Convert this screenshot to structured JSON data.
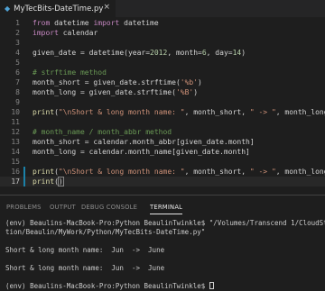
{
  "tab": {
    "title": "MyTecBits-DateTime.py",
    "close_glyph": "×",
    "file_icon_glyph": "◆"
  },
  "editor": {
    "active_line": 17,
    "lines": [
      {
        "num": "1",
        "tokens": [
          {
            "t": "from",
            "c": "kw"
          },
          {
            "t": " datetime "
          },
          {
            "t": "import",
            "c": "kw"
          },
          {
            "t": " datetime"
          }
        ]
      },
      {
        "num": "2",
        "tokens": [
          {
            "t": "import",
            "c": "kw"
          },
          {
            "t": " calendar"
          }
        ]
      },
      {
        "num": "3",
        "tokens": []
      },
      {
        "num": "4",
        "tokens": [
          {
            "t": "given_date = datetime(year="
          },
          {
            "t": "2012",
            "c": "num"
          },
          {
            "t": ", month="
          },
          {
            "t": "6",
            "c": "num"
          },
          {
            "t": ", day="
          },
          {
            "t": "14",
            "c": "num"
          },
          {
            "t": ")"
          }
        ]
      },
      {
        "num": "5",
        "tokens": []
      },
      {
        "num": "6",
        "tokens": [
          {
            "t": "# strftime method",
            "c": "cm"
          }
        ]
      },
      {
        "num": "7",
        "tokens": [
          {
            "t": "month_short = given_date.strftime("
          },
          {
            "t": "'%b'",
            "c": "str"
          },
          {
            "t": ")"
          }
        ]
      },
      {
        "num": "8",
        "tokens": [
          {
            "t": "month_long = given_date.strftime("
          },
          {
            "t": "'%B'",
            "c": "str"
          },
          {
            "t": ")"
          }
        ]
      },
      {
        "num": "9",
        "tokens": []
      },
      {
        "num": "10",
        "tokens": [
          {
            "t": "print",
            "c": "fn"
          },
          {
            "t": "("
          },
          {
            "t": "\"\\nShort & long month name: \"",
            "c": "str"
          },
          {
            "t": ", month_short, "
          },
          {
            "t": "\" -> \"",
            "c": "str"
          },
          {
            "t": ", month_long)"
          }
        ]
      },
      {
        "num": "11",
        "tokens": []
      },
      {
        "num": "12",
        "tokens": [
          {
            "t": "# month_name / month_abbr method",
            "c": "cm"
          }
        ]
      },
      {
        "num": "13",
        "tokens": [
          {
            "t": "month_short = calendar.month_abbr[given_date.month]"
          }
        ]
      },
      {
        "num": "14",
        "tokens": [
          {
            "t": "month_long = calendar.month_name[given_date.month]"
          }
        ]
      },
      {
        "num": "15",
        "tokens": []
      },
      {
        "num": "16",
        "tokens": [
          {
            "t": "print",
            "c": "fn"
          },
          {
            "t": "("
          },
          {
            "t": "\"\\nShort & long month name: \"",
            "c": "str"
          },
          {
            "t": ", month_short, "
          },
          {
            "t": "\" -> \"",
            "c": "str"
          },
          {
            "t": ", month_long)"
          }
        ]
      },
      {
        "num": "17",
        "tokens": [
          {
            "t": "print",
            "c": "fn"
          },
          {
            "t": "("
          },
          {
            "t": ")",
            "c": "cursor"
          }
        ]
      }
    ]
  },
  "panel": {
    "tabs": [
      {
        "label": "PROBLEMS",
        "active": false
      },
      {
        "label": "OUTPUT",
        "active": false
      },
      {
        "label": "DEBUG CONSOLE",
        "active": false
      },
      {
        "label": "TERMINAL",
        "active": true
      }
    ]
  },
  "terminal": {
    "lines": [
      "(env) Beaulins-MacBook-Pro:Python BeaulinTwinkle$ \"/Volumes/Transcend 1/CloudStati",
      "tion/Beaulin/MyWork/Python/MyTecBits-DateTime.py\"",
      "",
      "Short & long month name:  Jun  ->  June",
      "",
      "Short & long month name:  Jun  ->  June",
      "",
      "(env) Beaulins-MacBook-Pro:Python BeaulinTwinkle$ "
    ]
  },
  "colors": {
    "background": "#1e1e1e",
    "keyword": "#c586c0",
    "string": "#ce9178",
    "number": "#b5cea8",
    "comment": "#6a9955",
    "function": "#dcdcaa"
  }
}
